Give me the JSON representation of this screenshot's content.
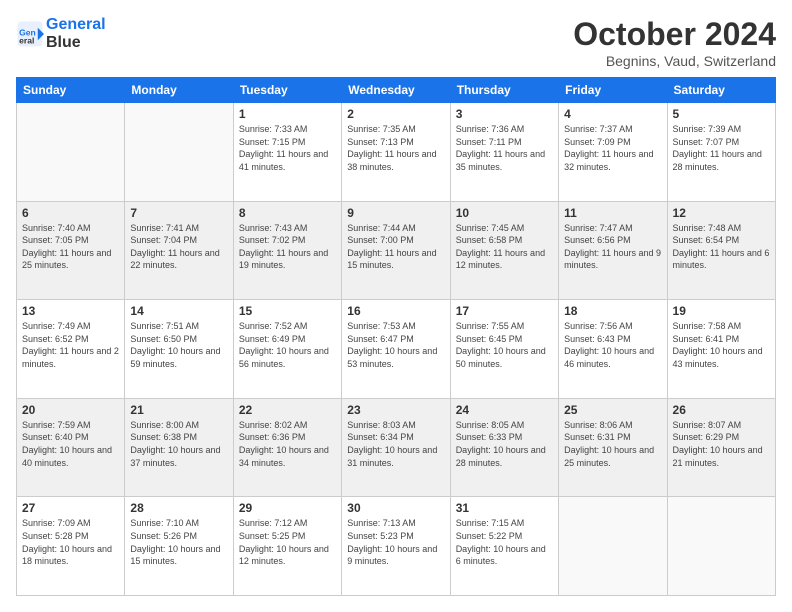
{
  "logo": {
    "line1": "General",
    "line2": "Blue"
  },
  "title": {
    "month": "October 2024",
    "location": "Begnins, Vaud, Switzerland"
  },
  "weekdays": [
    "Sunday",
    "Monday",
    "Tuesday",
    "Wednesday",
    "Thursday",
    "Friday",
    "Saturday"
  ],
  "weeks": [
    [
      {
        "day": "",
        "info": ""
      },
      {
        "day": "",
        "info": ""
      },
      {
        "day": "1",
        "info": "Sunrise: 7:33 AM\nSunset: 7:15 PM\nDaylight: 11 hours and 41 minutes."
      },
      {
        "day": "2",
        "info": "Sunrise: 7:35 AM\nSunset: 7:13 PM\nDaylight: 11 hours and 38 minutes."
      },
      {
        "day": "3",
        "info": "Sunrise: 7:36 AM\nSunset: 7:11 PM\nDaylight: 11 hours and 35 minutes."
      },
      {
        "day": "4",
        "info": "Sunrise: 7:37 AM\nSunset: 7:09 PM\nDaylight: 11 hours and 32 minutes."
      },
      {
        "day": "5",
        "info": "Sunrise: 7:39 AM\nSunset: 7:07 PM\nDaylight: 11 hours and 28 minutes."
      }
    ],
    [
      {
        "day": "6",
        "info": "Sunrise: 7:40 AM\nSunset: 7:05 PM\nDaylight: 11 hours and 25 minutes."
      },
      {
        "day": "7",
        "info": "Sunrise: 7:41 AM\nSunset: 7:04 PM\nDaylight: 11 hours and 22 minutes."
      },
      {
        "day": "8",
        "info": "Sunrise: 7:43 AM\nSunset: 7:02 PM\nDaylight: 11 hours and 19 minutes."
      },
      {
        "day": "9",
        "info": "Sunrise: 7:44 AM\nSunset: 7:00 PM\nDaylight: 11 hours and 15 minutes."
      },
      {
        "day": "10",
        "info": "Sunrise: 7:45 AM\nSunset: 6:58 PM\nDaylight: 11 hours and 12 minutes."
      },
      {
        "day": "11",
        "info": "Sunrise: 7:47 AM\nSunset: 6:56 PM\nDaylight: 11 hours and 9 minutes."
      },
      {
        "day": "12",
        "info": "Sunrise: 7:48 AM\nSunset: 6:54 PM\nDaylight: 11 hours and 6 minutes."
      }
    ],
    [
      {
        "day": "13",
        "info": "Sunrise: 7:49 AM\nSunset: 6:52 PM\nDaylight: 11 hours and 2 minutes."
      },
      {
        "day": "14",
        "info": "Sunrise: 7:51 AM\nSunset: 6:50 PM\nDaylight: 10 hours and 59 minutes."
      },
      {
        "day": "15",
        "info": "Sunrise: 7:52 AM\nSunset: 6:49 PM\nDaylight: 10 hours and 56 minutes."
      },
      {
        "day": "16",
        "info": "Sunrise: 7:53 AM\nSunset: 6:47 PM\nDaylight: 10 hours and 53 minutes."
      },
      {
        "day": "17",
        "info": "Sunrise: 7:55 AM\nSunset: 6:45 PM\nDaylight: 10 hours and 50 minutes."
      },
      {
        "day": "18",
        "info": "Sunrise: 7:56 AM\nSunset: 6:43 PM\nDaylight: 10 hours and 46 minutes."
      },
      {
        "day": "19",
        "info": "Sunrise: 7:58 AM\nSunset: 6:41 PM\nDaylight: 10 hours and 43 minutes."
      }
    ],
    [
      {
        "day": "20",
        "info": "Sunrise: 7:59 AM\nSunset: 6:40 PM\nDaylight: 10 hours and 40 minutes."
      },
      {
        "day": "21",
        "info": "Sunrise: 8:00 AM\nSunset: 6:38 PM\nDaylight: 10 hours and 37 minutes."
      },
      {
        "day": "22",
        "info": "Sunrise: 8:02 AM\nSunset: 6:36 PM\nDaylight: 10 hours and 34 minutes."
      },
      {
        "day": "23",
        "info": "Sunrise: 8:03 AM\nSunset: 6:34 PM\nDaylight: 10 hours and 31 minutes."
      },
      {
        "day": "24",
        "info": "Sunrise: 8:05 AM\nSunset: 6:33 PM\nDaylight: 10 hours and 28 minutes."
      },
      {
        "day": "25",
        "info": "Sunrise: 8:06 AM\nSunset: 6:31 PM\nDaylight: 10 hours and 25 minutes."
      },
      {
        "day": "26",
        "info": "Sunrise: 8:07 AM\nSunset: 6:29 PM\nDaylight: 10 hours and 21 minutes."
      }
    ],
    [
      {
        "day": "27",
        "info": "Sunrise: 7:09 AM\nSunset: 5:28 PM\nDaylight: 10 hours and 18 minutes."
      },
      {
        "day": "28",
        "info": "Sunrise: 7:10 AM\nSunset: 5:26 PM\nDaylight: 10 hours and 15 minutes."
      },
      {
        "day": "29",
        "info": "Sunrise: 7:12 AM\nSunset: 5:25 PM\nDaylight: 10 hours and 12 minutes."
      },
      {
        "day": "30",
        "info": "Sunrise: 7:13 AM\nSunset: 5:23 PM\nDaylight: 10 hours and 9 minutes."
      },
      {
        "day": "31",
        "info": "Sunrise: 7:15 AM\nSunset: 5:22 PM\nDaylight: 10 hours and 6 minutes."
      },
      {
        "day": "",
        "info": ""
      },
      {
        "day": "",
        "info": ""
      }
    ]
  ]
}
